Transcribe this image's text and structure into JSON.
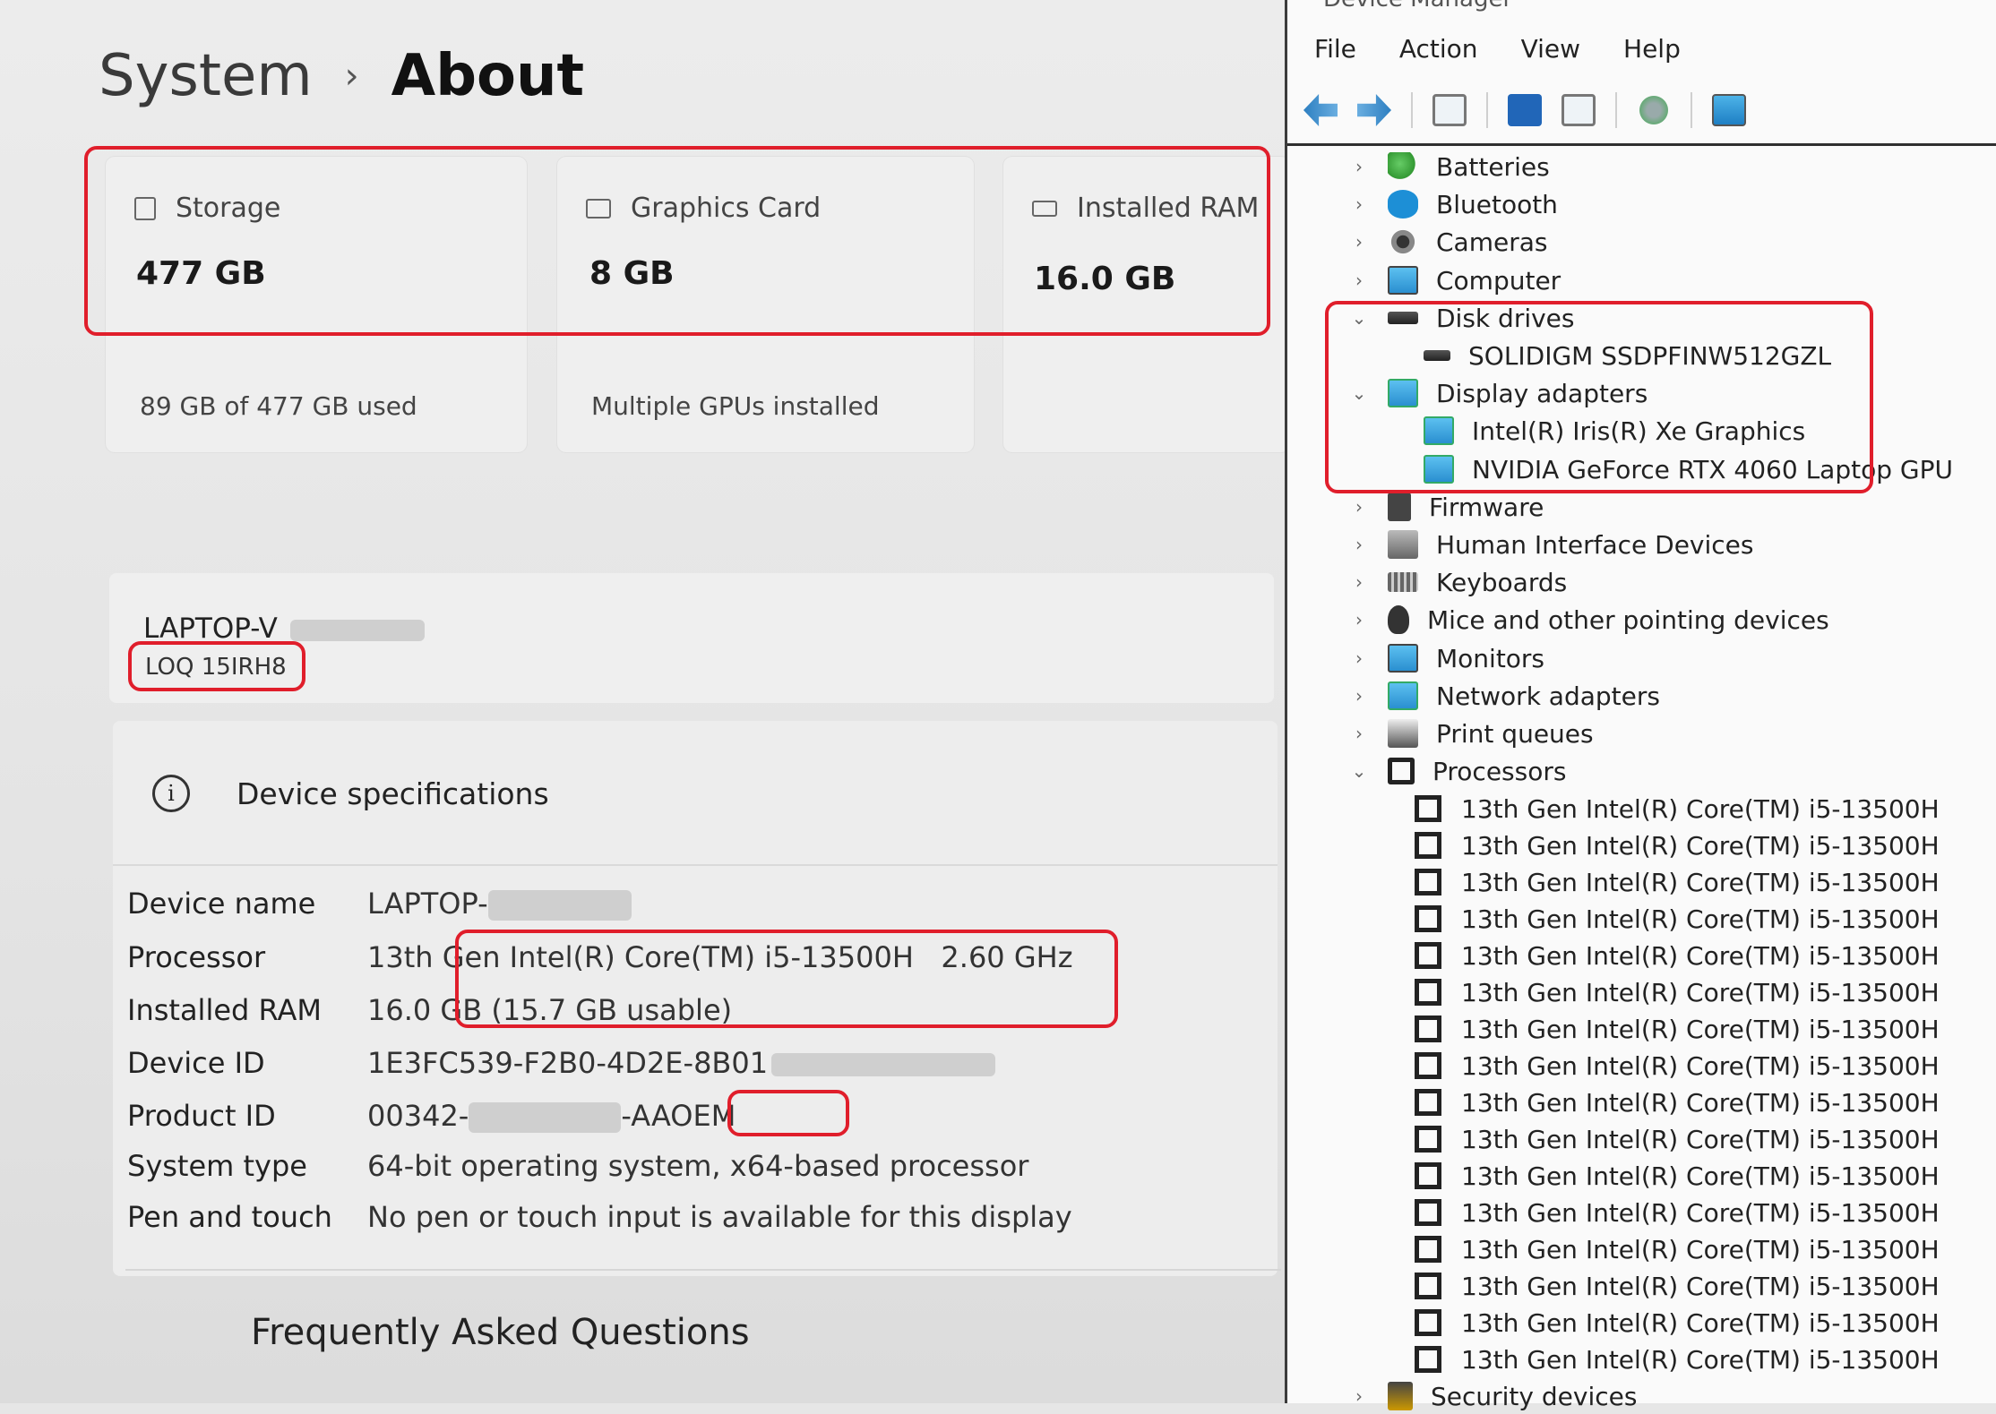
{
  "settings": {
    "breadcrumb": {
      "parent": "System",
      "separator": "›",
      "current": "About"
    },
    "cards": {
      "storage": {
        "label": "Storage",
        "value": "477 GB",
        "sub": "89 GB of 477 GB used"
      },
      "graphics": {
        "label": "Graphics Card",
        "value": "8 GB",
        "sub": "Multiple GPUs installed"
      },
      "ram": {
        "label": "Installed RAM",
        "value": "16.0 GB",
        "sub": ""
      }
    },
    "device": {
      "name": "LAPTOP-V",
      "model": "LOQ 15IRH8"
    },
    "specs": {
      "title": "Device specifications",
      "rows": [
        {
          "key": "Device name",
          "value": "LAPTOP-"
        },
        {
          "key": "Processor",
          "value": "13th Gen Intel(R) Core(TM) i5-13500H   2.60 GHz"
        },
        {
          "key": "Installed RAM",
          "value": "16.0 GB (15.7 GB usable)"
        },
        {
          "key": "Device ID",
          "value": "1E3FC539-F2B0-4D2E-8B01"
        },
        {
          "key": "Product ID",
          "value": "00342-",
          "value_suffix": "-AAOEM"
        },
        {
          "key": "System type",
          "value": "64-bit operating system, x64-based processor"
        },
        {
          "key": "Pen and touch",
          "value": "No pen or touch input is available for this display"
        }
      ]
    },
    "faq": "Frequently Asked Questions"
  },
  "device_manager": {
    "title": "Device Manager",
    "menu": [
      "File",
      "Action",
      "View",
      "Help"
    ],
    "tree": [
      {
        "label": "Batteries",
        "expanded": false
      },
      {
        "label": "Bluetooth",
        "expanded": false
      },
      {
        "label": "Cameras",
        "expanded": false
      },
      {
        "label": "Computer",
        "expanded": false
      },
      {
        "label": "Disk drives",
        "expanded": true
      },
      {
        "label": "SOLIDIGM SSDPFINW512GZL",
        "child": true
      },
      {
        "label": "Display adapters",
        "expanded": true
      },
      {
        "label": "Intel(R) Iris(R) Xe Graphics",
        "child": true
      },
      {
        "label": "NVIDIA GeForce RTX 4060 Laptop GPU",
        "child": true
      },
      {
        "label": "Firmware",
        "expanded": false
      },
      {
        "label": "Human Interface Devices",
        "expanded": false
      },
      {
        "label": "Keyboards",
        "expanded": false
      },
      {
        "label": "Mice and other pointing devices",
        "expanded": false
      },
      {
        "label": "Monitors",
        "expanded": false
      },
      {
        "label": "Network adapters",
        "expanded": false
      },
      {
        "label": "Print queues",
        "expanded": false
      },
      {
        "label": "Processors",
        "expanded": true
      }
    ],
    "processor_item": "13th Gen Intel(R) Core(TM) i5-13500H",
    "processor_count": 16,
    "last_item": "Security devices"
  },
  "colors": {
    "highlight": "#e01e2b",
    "tree_icon_blue": "#1d8fd6"
  }
}
